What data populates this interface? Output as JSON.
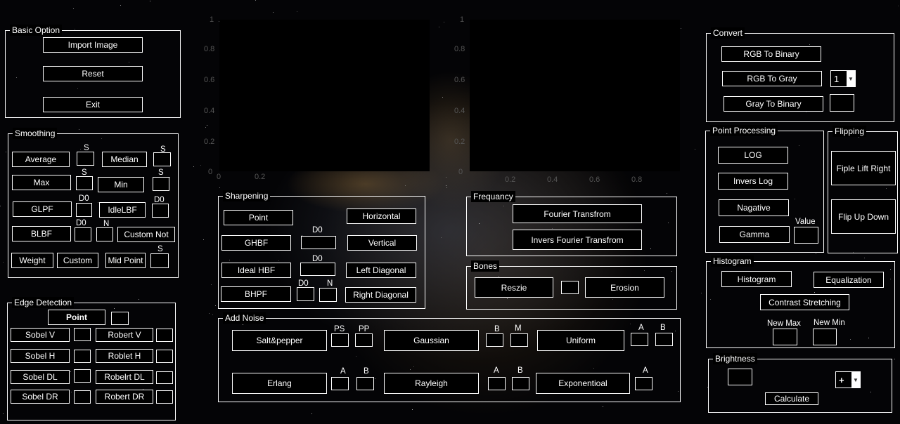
{
  "basic": {
    "title": "Basic Option",
    "import": "Import Image",
    "reset": "Reset",
    "exit": "Exit"
  },
  "smoothing": {
    "title": "Smoothing",
    "average": "Average",
    "median": "Median",
    "max": "Max",
    "min": "Min",
    "glpf": "GLPF",
    "idlelbf": "IdleLBF",
    "blbf": "BLBF",
    "custom_not": "Custom Not",
    "weight": "Weight",
    "custom": "Custom",
    "mid_point": "Mid Point",
    "s": "S",
    "d0": "D0",
    "n": "N"
  },
  "edge": {
    "title": "Edge Detection",
    "point": "Point",
    "sobel_v": "Sobel V",
    "robert_v": "Robert V",
    "sobel_h": "Sobel H",
    "roblet_h": "Roblet H",
    "sobel_dl": "Sobel DL",
    "robelrt_dl": "Robelrt DL",
    "sobel_dr": "Sobel DR",
    "robert_dr": "Robert DR"
  },
  "plots": {
    "ticks": [
      "0",
      "0.2",
      "0.4",
      "0.6",
      "0.8",
      "1"
    ]
  },
  "sharpening": {
    "title": "Sharpening",
    "point": "Point",
    "ghbf": "GHBF",
    "ideal_hbf": "Ideal HBF",
    "bhpf": "BHPF",
    "horizontal": "Horizontal",
    "vertical": "Vertical",
    "left_diagonal": "Left Diagonal",
    "right_diagonal": "Right Diagonal",
    "d0": "D0",
    "n": "N"
  },
  "frequency": {
    "title": "Frequancy",
    "fourier": "Fourier Transfrom",
    "inverse": "Invers Fourier Transfrom"
  },
  "bones": {
    "title": "Bones",
    "resize": "Reszie",
    "erosion": "Erosion"
  },
  "noise": {
    "title": "Add Noise",
    "salt": "Salt&pepper",
    "gaussian": "Gaussian",
    "uniform": "Uniform",
    "erlang": "Erlang",
    "rayleigh": "Rayleigh",
    "exponential": "Exponentioal",
    "ps": "PS",
    "pp": "PP",
    "a": "A",
    "b": "B",
    "m": "M"
  },
  "convert": {
    "title": "Convert",
    "rgb_binary": "RGB To Binary",
    "rgb_gray": "RGB To Gray",
    "gray_binary": "Gray To Binary",
    "select_value": "1"
  },
  "point_processing": {
    "title": "Point Processing",
    "log": "LOG",
    "invers_log": "Invers Log",
    "negative": "Nagative",
    "gamma": "Gamma",
    "value": "Value"
  },
  "flipping": {
    "title": "Flipping",
    "lr": "Fiple Lift Right",
    "ud": "Flip Up Down"
  },
  "histogram": {
    "title": "Histogram",
    "histogram": "Histogram",
    "equalization": "Equalization",
    "contrast": "Contrast Stretching",
    "new_max": "New Max",
    "new_min": "New Min"
  },
  "brightness": {
    "title": "Brightness",
    "calculate": "Calculate",
    "op": "+"
  }
}
